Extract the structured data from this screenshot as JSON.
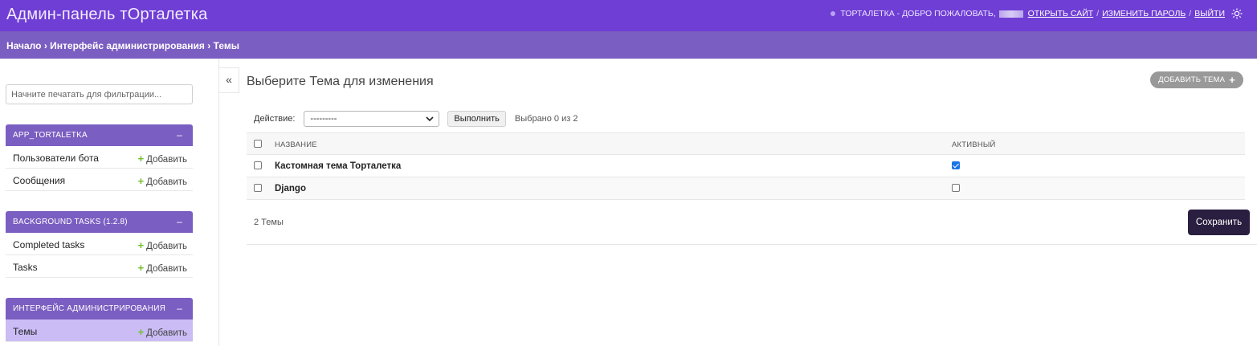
{
  "header": {
    "brand": "Админ-панель тОрталетка",
    "welcome": "ТОРТАЛЕТКА - ДОБРО ПОЖАЛОВАТЬ,",
    "view_site": "ОТКРЫТЬ САЙТ",
    "change_password": "ИЗМЕНИТЬ ПАРОЛЬ",
    "logout": "ВЫЙТИ",
    "separator": "/"
  },
  "breadcrumbs": {
    "home": "Начало",
    "section": "Интерфейс администрирования",
    "current": "Темы",
    "sep": "›"
  },
  "sidebar": {
    "filter_placeholder": "Начните печатать для фильтрации...",
    "collapse_symbol": "–",
    "add_label": "Добавить",
    "modules": [
      {
        "caption": "APP_TORTALETKA",
        "models": [
          "Пользователи бота",
          "Сообщения"
        ]
      },
      {
        "caption": "BACKGROUND TASKS (1.2.8)",
        "models": [
          "Completed tasks",
          "Tasks"
        ]
      },
      {
        "caption": "ИНТЕРФЕЙС АДМИНИСТРИРОВАНИЯ",
        "models": [
          "Темы"
        ]
      }
    ],
    "toggle_symbol": "«"
  },
  "main": {
    "title": "Выберите Тема для изменения",
    "add_button": "ДОБАВИТЬ ТЕМА",
    "action_label": "Действие:",
    "action_selected": "---------",
    "go_button": "Выполнить",
    "counter": "Выбрано 0 из 2",
    "columns": [
      "НАЗВАНИЕ",
      "АКТИВНЫЙ"
    ],
    "rows": [
      {
        "name": "Кастомная тема Торталетка",
        "active": true
      },
      {
        "name": "Django",
        "active": false
      }
    ],
    "result_count": "2 Темы",
    "save_button": "Сохранить"
  },
  "colors": {
    "header": "#6f3ed4",
    "breadcrumbs": "#7b5ec1",
    "module_caption": "#7b5ec1",
    "current_model": "#cbbcf6",
    "add_plus": "#70bf2b",
    "save_button": "#2a1f40"
  },
  "icons": {
    "theme_toggle": "sun-icon",
    "dropdown": "chevron-down-icon",
    "add": "plus-icon"
  }
}
